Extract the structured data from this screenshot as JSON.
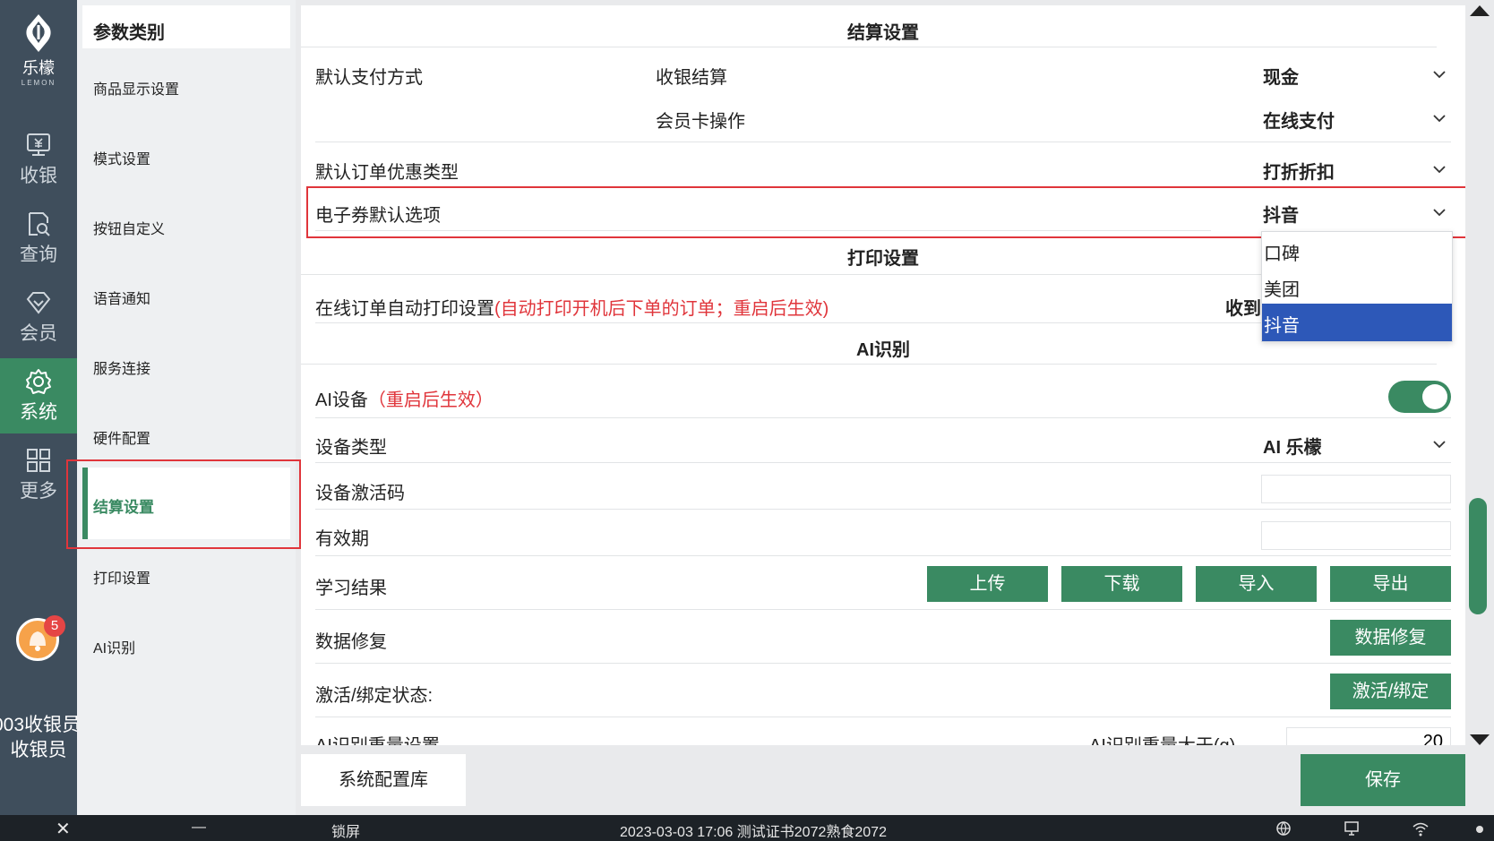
{
  "nav": {
    "logo_text": "乐檬",
    "logo_sub": "LEMON",
    "items": [
      {
        "label": "收银",
        "icon": "cash-register-icon"
      },
      {
        "label": "查询",
        "icon": "search-document-icon"
      },
      {
        "label": "会员",
        "icon": "diamond-icon"
      },
      {
        "label": "系统",
        "icon": "gear-icon"
      },
      {
        "label": "更多",
        "icon": "grid-icon"
      }
    ],
    "badge_count": "5",
    "user_line1": "003收银员",
    "user_line2": "收银员"
  },
  "categories": {
    "header": "参数类别",
    "items": [
      "商品显示设置",
      "模式设置",
      "按钮自定义",
      "语音通知",
      "服务连接",
      "硬件配置",
      "结算设置",
      "打印设置",
      "AI识别"
    ],
    "active": "结算设置"
  },
  "settlement": {
    "title": "结算设置",
    "default_payment_label": "默认支付方式",
    "checkout_label": "收银结算",
    "checkout_value": "现金",
    "member_card_label": "会员卡操作",
    "member_card_value": "在线支付",
    "discount_type_label": "默认订单优惠类型",
    "discount_type_value": "打折折扣",
    "ecoupon_label": "电子券默认选项",
    "ecoupon_value": "抖音",
    "ecoupon_options": [
      "口碑",
      "美团",
      "抖音"
    ]
  },
  "print": {
    "title": "打印设置",
    "auto_print_label": "在线订单自动打印设置",
    "auto_print_hint": "(自动打印开机后下单的订单；重启后生效)",
    "auto_print_value": "收到"
  },
  "ai": {
    "title": "AI识别",
    "device_label": "AI设备",
    "device_hint": "（重启后生效）",
    "device_enabled": true,
    "device_type_label": "设备类型",
    "device_type_value": "AI 乐檬",
    "activation_code_label": "设备激活码",
    "activation_code_value": "",
    "validity_label": "有效期",
    "validity_value": "",
    "learning_label": "学习结果",
    "learning_buttons": [
      "上传",
      "下载",
      "导入",
      "导出"
    ],
    "repair_label": "数据修复",
    "repair_button": "数据修复",
    "bind_label": "激活/绑定状态:",
    "bind_button": "激活/绑定",
    "weight_label": "AI识别重量设置",
    "weight_gt_label": "AI识别重量大于(g)",
    "weight_gt_value": "20"
  },
  "footer": {
    "config_button": "系统配置库",
    "save_button": "保存"
  },
  "taskbar": {
    "close": "✕",
    "minimize": "—",
    "lock": "锁屏",
    "status": "2023-03-03 17:06  测试证书2072熟食2072"
  },
  "colors": {
    "accent": "#3a8a62",
    "nav_bg": "#3f4e5c",
    "highlight_red": "#e0353b",
    "selected_blue": "#2d58b8"
  }
}
